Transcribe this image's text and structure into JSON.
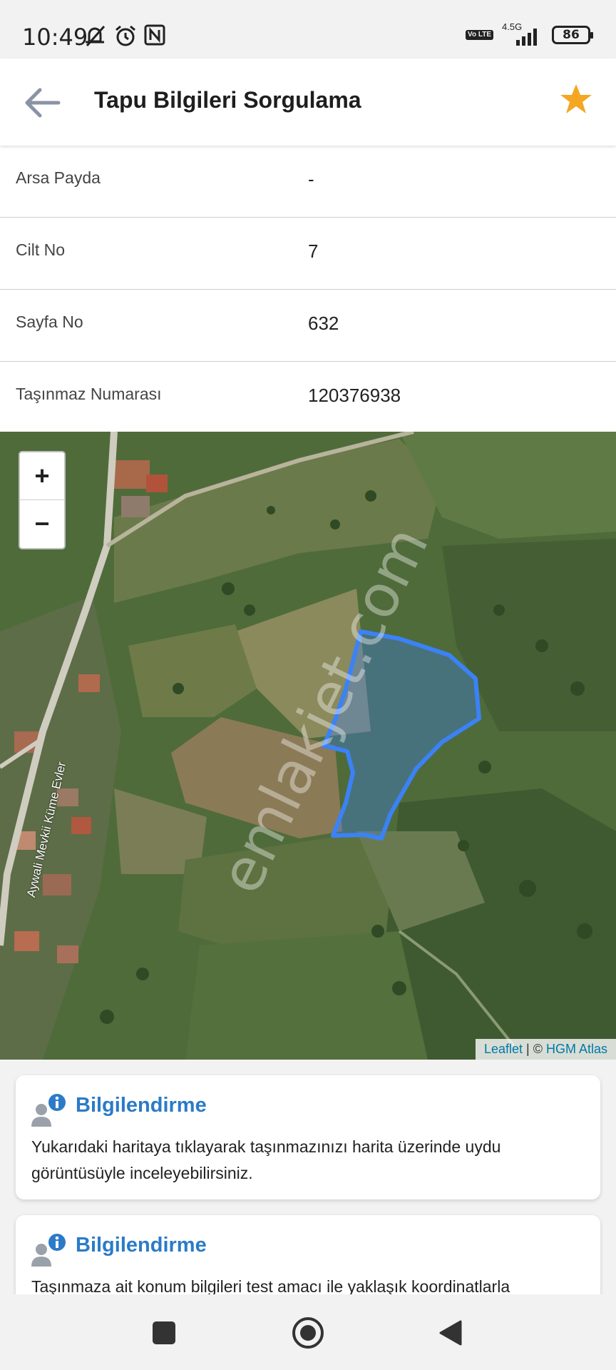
{
  "status_bar": {
    "time": "10:49",
    "network": "4.5G",
    "volte": "Vo LTE",
    "battery": "86"
  },
  "app_bar": {
    "title": "Tapu Bilgileri Sorgulama",
    "back_icon": "arrow-left-icon",
    "favorite_icon": "star-icon",
    "favorite_color": "#f5a623"
  },
  "info_rows": [
    {
      "label": "Arsa Payda",
      "value": "-"
    },
    {
      "label": "Cilt No",
      "value": "7"
    },
    {
      "label": "Sayfa No",
      "value": "632"
    },
    {
      "label": "Taşınmaz Numarası",
      "value": "120376938"
    }
  ],
  "map": {
    "zoom_in": "+",
    "zoom_out": "−",
    "watermark": "emlakjet.com",
    "road_label": "Aywali Mevkii Küme Evler",
    "attribution": {
      "leaflet": "Leaflet",
      "separator": " | © ",
      "source": "HGM Atlas"
    },
    "parcel_color": "#3b82f6"
  },
  "cards": [
    {
      "title": "Bilgilendirme",
      "text": "Yukarıdaki haritaya tıklayarak taşınmazınızı harita üzerinde uydu görüntüsüyle inceleyebilirsiniz."
    },
    {
      "title": "Bilgilendirme",
      "text": "Taşınmaza ait konum bilgileri test amacı ile yaklaşık koordinatlarla"
    }
  ],
  "accent_color": "#2b7bc7"
}
